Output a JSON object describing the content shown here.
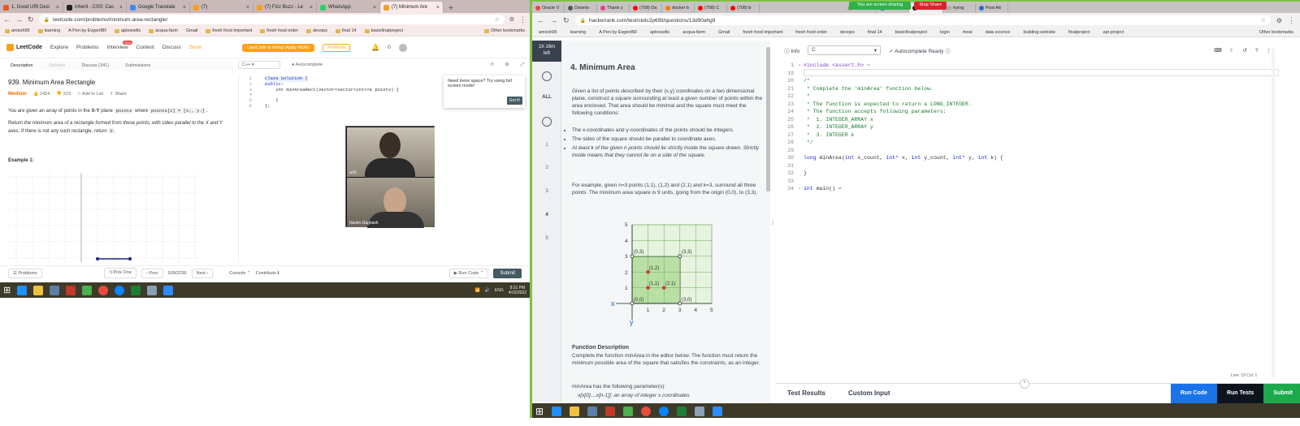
{
  "left": {
    "tabs": [
      "1. Good URI Desi",
      "inherit - CSS: Cas",
      "Google Translate",
      "(7)",
      "(7) Fizz Buzz - Le",
      "WhatsApp",
      "(7) Minimum Are"
    ],
    "url": "leetcode.com/problems/minimum-area-rectangle/",
    "bookmarks": [
      "amirsh95",
      "learning",
      "A Pen by EvgenBR",
      "aplessells",
      "acqua-farm",
      "Gmail",
      "fresh food important",
      "fresh food order",
      "devops",
      "final 14",
      "basicfinalproject",
      "Other bookmarks"
    ],
    "nav": {
      "logo": "LeetCode",
      "explore": "Explore",
      "problems": "Problems",
      "interview": "Interview",
      "new_badge": "New",
      "contest": "Contest",
      "discuss": "Discuss",
      "store": "Store",
      "promo": "LeetCode is hiring! Apply NOW.",
      "premium": "Premium",
      "notif_count": "2",
      "coins": "0"
    },
    "desc_tabs": [
      "Description",
      "Solution",
      "Discuss (341)",
      "Submissions"
    ],
    "problem": {
      "title": "939. Minimum Area Rectangle",
      "difficulty": "Medium",
      "likes": "1424",
      "dislikes": "223",
      "add_to_list": "Add to List",
      "share": "Share",
      "p1_pre": "You are given an array of points in the ",
      "p1_bold": "X-Y",
      "p1_mid": " plane ",
      "p1_code1": "points",
      "p1_mid2": " where ",
      "p1_code2": "points[i] = [xᵢ, yᵢ]",
      "p2_pre": "Return ",
      "p2_em": "the minimum area of a rectangle formed from these points, with sides parallel to the X and Y axes",
      "p2_post": ". If there is not any such rectangle, return ",
      "p2_code": "0",
      "example": "Example 1:"
    },
    "editor": {
      "lang": "C++",
      "autocomplete": "Autocomplete",
      "lines": [
        "class Solution {",
        "public:",
        "    int minAreaRect(vector<vector<int>>& points) {",
        "",
        "    }",
        "};"
      ],
      "line_numbers": [
        "1",
        "2",
        "3",
        "4",
        "5",
        "6"
      ]
    },
    "popup": {
      "text": "Need more space? Try using full screen mode!",
      "button": "Got it!"
    },
    "video": {
      "name1": "ar1t",
      "name2": "Nasim Daghash"
    },
    "bottom": {
      "problems": "Problems",
      "pick_one": "Pick One",
      "prev": "Prev",
      "counter": "939/2236",
      "next": "Next",
      "console": "Console",
      "contribute": "Contribute",
      "run": "Run Code",
      "submit": "Submit"
    },
    "tray": {
      "lang": "ENG",
      "time": "8:31 PM",
      "date": "4/15/2022"
    }
  },
  "right": {
    "tabs": [
      "Oracle V",
      "Downlo",
      "Thank y",
      "(708) Da",
      "docker b",
      "(708) C",
      "(708) b",
      "Extensi",
      "HP Indi",
      "HackerR",
      "trying",
      "Post Att"
    ],
    "share": {
      "sharing": "You are screen sharing",
      "stop": "Stop Share"
    },
    "url": "hackerrank.com/test/ckdc2p65lt/questions/13d90ahg9",
    "bookmarks": [
      "amirsh95",
      "learning",
      "A Pen by EvgenBR",
      "aplessells",
      "acqua-farm",
      "Gmail",
      "fresh food important",
      "fresh food order",
      "devops",
      "final 14",
      "basicfinalproject",
      "login",
      "meal",
      "data science",
      "building-website",
      "finalproject",
      "api-project",
      "Other bookmarks"
    ],
    "sidebar": {
      "timer1": "1h 16m",
      "timer2": "left",
      "all": "ALL",
      "q1": "1",
      "q2": "2",
      "q3": "3",
      "q4": "4",
      "q5": "5"
    },
    "question": {
      "title": "4. Minimum Area",
      "p1": "Given a list of points described by their (x,y) coordinates on a two dimensional plane, construct a square surrounding at least a given number of points within the area enclosed. That area should be minimal and the square must meet the following conditions:",
      "b1": "The x-coordinates and y-coordinates of the points should be integers.",
      "b2": "The sides of the square should be parallel to coordinate axes.",
      "b3": "At least k of the given n points should lie strictly inside the square drawn. Strictly inside means that they cannot lie on a side of the square.",
      "p2": "For example, given n=3 points (1,1), (1,2) and (2,1) and k=3, surround all three points. The minimum area square is 9 units, going from the origin (0,0), to (3,3).",
      "fd_title": "Function Description",
      "fd_text": "Complete the function minArea in the editor below. The function must return the minimum possible area of the square that satisfies the constraints, as an integer.",
      "params": "minArea has the following parameter(s):",
      "param1": "x[x[0]....x[n-1]]: an array of integer x coordinates"
    },
    "figure": {
      "y_ticks": [
        "5",
        "4",
        "3",
        "2",
        "1"
      ],
      "x_ticks": [
        "1",
        "2",
        "3",
        "4",
        "5"
      ],
      "x_axis": "x",
      "y_axis": "y",
      "labels": [
        "(0,3)",
        "(3,3)",
        "(1,2)",
        "(1,1)",
        "(2,1)",
        "(0,0)",
        "(3,0)"
      ]
    },
    "editor": {
      "info": "Info",
      "lang": "C",
      "autocomplete": "Autocomplete Ready",
      "line_numbers": [
        "1",
        "19",
        "20",
        "21",
        "22",
        "23",
        "24",
        "25",
        "26",
        "27",
        "28",
        "29",
        "30",
        "31",
        "32",
        "33",
        "34"
      ],
      "l1": "#include <assert.h>",
      "l20": "/*",
      "l21": " * Complete the 'minArea' function below.",
      "l22": " *",
      "l23": " * The function is expected to return a LONG_INTEGER.",
      "l24": " * The function accepts following parameters:",
      "l25": " *  1. INTEGER_ARRAY x",
      "l26": " *  2. INTEGER_ARRAY y",
      "l27": " *  3. INTEGER k",
      "l28": " */",
      "l30a": "long",
      "l30b": " minArea(",
      "l30c": "int",
      "l30d": " x_count, ",
      "l30e": "int*",
      "l30f": " x, ",
      "l30g": "int",
      "l30h": " y_count, ",
      "l30i": "int*",
      "l30j": " y, ",
      "l30k": "int",
      "l30l": " k) {",
      "l32": "}",
      "l34a": "int",
      "l34b": " main()",
      "status": "Line: 19 Col: 1"
    },
    "bottom": {
      "results": "Test Results",
      "custom": "Custom Input",
      "run": "Run Code",
      "tests": "Run Tests",
      "submit": "Submit"
    },
    "colors": {
      "hr_green": "#1ba94c",
      "hr_blue": "#1a73e8",
      "hr_dark": "#0e141e"
    }
  }
}
